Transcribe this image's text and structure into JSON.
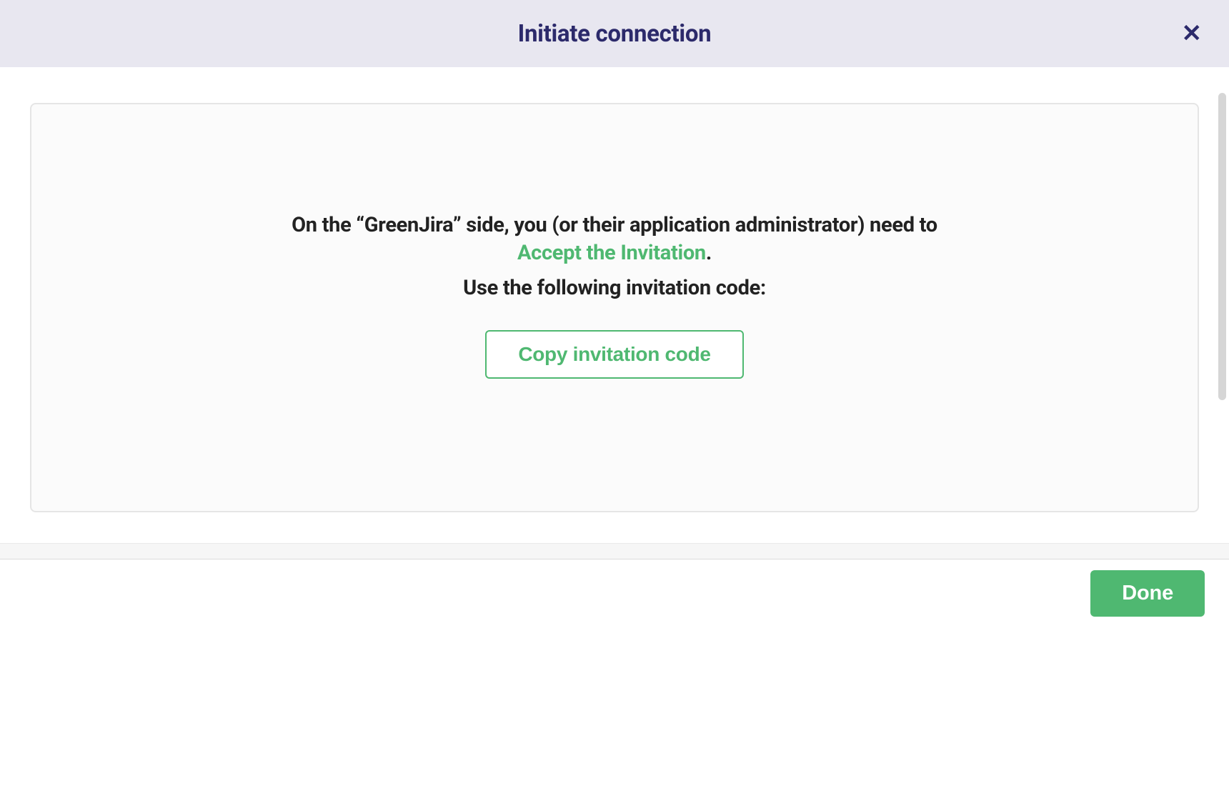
{
  "header": {
    "title": "Initiate connection",
    "close_icon": "✕"
  },
  "content": {
    "instruction_prefix": "On the “",
    "side_name": "GreenJira",
    "instruction_mid": "” side, you (or their application administrator) need to ",
    "accept_link_text": "Accept the Invitation",
    "instruction_suffix": ".",
    "use_code_text": "Use the following invitation code:",
    "copy_button_label": "Copy invitation code"
  },
  "footer": {
    "done_label": "Done"
  }
}
